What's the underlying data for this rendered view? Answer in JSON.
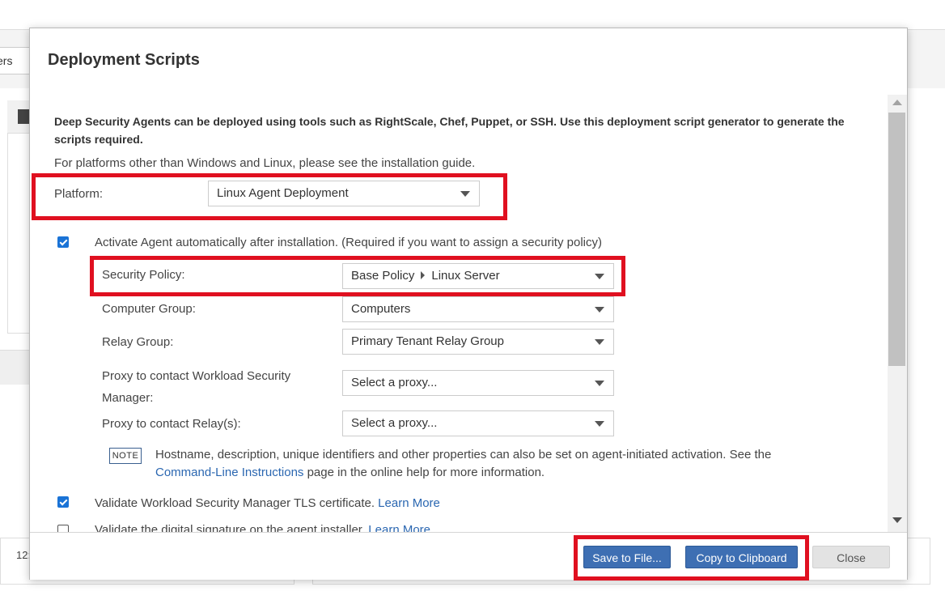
{
  "background": {
    "tab_fragment": "ers",
    "card_text_fragment": "12:"
  },
  "dialog": {
    "title": "Deployment Scripts",
    "intro": "Deep Security Agents can be deployed using tools such as RightScale, Chef, Puppet, or SSH. Use this deployment script generator to generate the scripts required.",
    "platform_note": "For platforms other than Windows and Linux, please see the installation guide.",
    "platform": {
      "label": "Platform:",
      "value": "Linux Agent Deployment"
    },
    "activate": {
      "checked": true,
      "label": "Activate Agent automatically after installation. (Required if you want to assign a security policy)"
    },
    "security_policy": {
      "label": "Security Policy:",
      "path": [
        "Base Policy",
        "Linux Server"
      ]
    },
    "computer_group": {
      "label": "Computer Group:",
      "value": "Computers"
    },
    "relay_group": {
      "label": "Relay Group:",
      "value": "Primary Tenant Relay Group"
    },
    "proxy_manager": {
      "label_line1": "Proxy to contact Workload Security",
      "label_line2": "Manager:",
      "value": "Select a proxy..."
    },
    "proxy_relay": {
      "label": "Proxy to contact Relay(s):",
      "value": "Select a proxy..."
    },
    "note": {
      "badge": "NOTE",
      "text_before": "Hostname, description, unique identifiers and other properties can also be set on agent-initiated activation. See the",
      "link": "Command-Line Instructions",
      "text_after": "page in the online help for more information."
    },
    "validate_tls": {
      "checked": true,
      "label": "Validate Workload Security Manager TLS certificate.",
      "link": "Learn More"
    },
    "validate_signature": {
      "checked": false,
      "label": "Validate the digital signature on the agent installer.",
      "link": "Learn More"
    },
    "buttons": {
      "save": "Save to File...",
      "copy": "Copy to Clipboard",
      "close": "Close"
    }
  },
  "colors": {
    "highlight": "#e01020",
    "primary_button": "#3e6fb3",
    "link": "#2b67b1",
    "checkbox": "#1a73d6"
  }
}
